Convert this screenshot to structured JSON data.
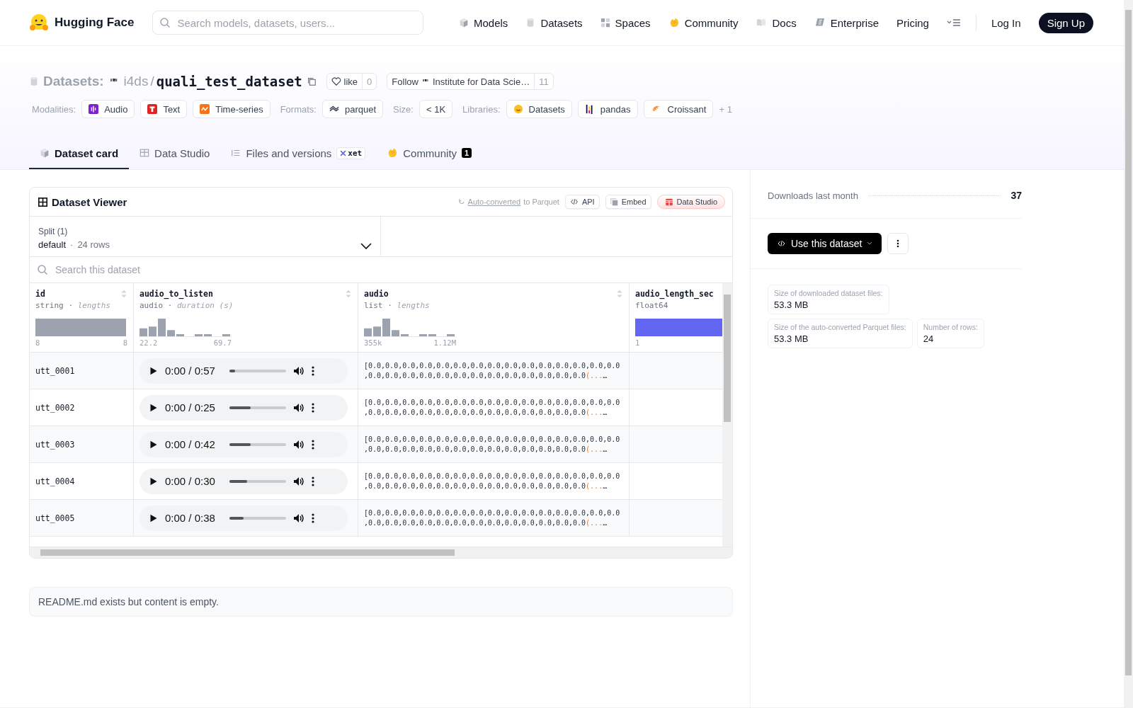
{
  "header": {
    "brand": "Hugging Face",
    "search_placeholder": "Search models, datasets, users...",
    "nav": [
      {
        "label": "Models"
      },
      {
        "label": "Datasets"
      },
      {
        "label": "Spaces"
      },
      {
        "label": "Community"
      },
      {
        "label": "Docs"
      },
      {
        "label": "Enterprise"
      },
      {
        "label": "Pricing"
      }
    ],
    "log_in": "Log In",
    "sign_up": "Sign Up"
  },
  "repo": {
    "section": "Datasets:",
    "owner": "i4ds",
    "separator": "/",
    "name": "quali_test_dataset",
    "like": {
      "label": "like",
      "count": "0"
    },
    "follow": {
      "label": "Follow",
      "org": "Institute for Data Scie…",
      "count": "11"
    }
  },
  "tag_groups": [
    {
      "label": "Modalities:",
      "tags": [
        "Audio",
        "Text",
        "Time-series"
      ]
    },
    {
      "label": "Formats:",
      "tags": [
        "parquet"
      ]
    },
    {
      "label": "Size:",
      "tags": [
        "< 1K"
      ]
    },
    {
      "label": "Libraries:",
      "tags": [
        "Datasets",
        "pandas",
        "Croissant"
      ]
    }
  ],
  "more_tags": "+ 1",
  "tabs": [
    {
      "label": "Dataset card",
      "selected": true
    },
    {
      "label": "Data Studio",
      "selected": false
    },
    {
      "label": "Files and versions",
      "selected": false,
      "badge": "xet"
    },
    {
      "label": "Community",
      "selected": false,
      "count": "1"
    }
  ],
  "viewer": {
    "title": "Dataset Viewer",
    "converted_link": "Auto-converted",
    "converted_rest": "to Parquet",
    "buttons": [
      "API",
      "Embed"
    ],
    "studio_button": "Data Studio",
    "split": {
      "label": "Split (1)",
      "value": "default",
      "separator": "·",
      "rows": "24 rows"
    },
    "search_placeholder": "Search this dataset",
    "type_separator": "·",
    "columns": [
      {
        "name": "id",
        "dtype": "string",
        "stat": "lengths",
        "min": "8",
        "max": "8",
        "sortable": true,
        "kind": "flat"
      },
      {
        "name": "audio_to_listen",
        "dtype": "audio",
        "stat": "duration (s)",
        "min": "22.2",
        "max": "69.7",
        "sortable": true,
        "kind": "histogram"
      },
      {
        "name": "audio",
        "dtype": "list",
        "stat": "lengths",
        "min": "355k",
        "max": "1.12M",
        "sortable": true,
        "kind": "histogram"
      },
      {
        "name": "audio_length_sec",
        "dtype": "float64",
        "min": "1",
        "kind": "solid"
      }
    ],
    "rows": [
      {
        "id": "utt_0001",
        "time": "0:00 / 0:57",
        "level": 0.1,
        "lines": [
          "[0.0,0.0,0.0,0.0,0.0,0.0,0.0,0.0,0.0,0.0,0.0,0.0,0.0,0.0,0.0",
          ",0.0,0.0,0.0,0.0,0.0,0.0,0.0,0.0,0.0,0.0,0.0,0.0,0.0"
        ],
        "more": "(...",
        "ellipsis": "…"
      },
      {
        "id": "utt_0002",
        "time": "0:00 / 0:25",
        "level": 0.37,
        "lines": [
          "[0.0,0.0,0.0,0.0,0.0,0.0,0.0,0.0,0.0,0.0,0.0,0.0,0.0,0.0,0.0",
          ",0.0,0.0,0.0,0.0,0.0,0.0,0.0,0.0,0.0,0.0,0.0,0.0,0.0"
        ],
        "more": "(...",
        "ellipsis": "…"
      },
      {
        "id": "utt_0003",
        "time": "0:00 / 0:42",
        "level": 0.37,
        "lines": [
          "[0.0,0.0,0.0,0.0,0.0,0.0,0.0,0.0,0.0,0.0,0.0,0.0,0.0,0.0,0.0",
          ",0.0,0.0,0.0,0.0,0.0,0.0,0.0,0.0,0.0,0.0,0.0,0.0,0.0"
        ],
        "more": "(...",
        "ellipsis": "…"
      },
      {
        "id": "utt_0004",
        "time": "0:00 / 0:30",
        "level": 0.31,
        "lines": [
          "[0.0,0.0,0.0,0.0,0.0,0.0,0.0,0.0,0.0,0.0,0.0,0.0,0.0,0.0,0.0",
          ",0.0,0.0,0.0,0.0,0.0,0.0,0.0,0.0,0.0,0.0,0.0,0.0,0.0"
        ],
        "more": "(...",
        "ellipsis": "…"
      },
      {
        "id": "utt_0005",
        "time": "0:00 / 0:38",
        "level": 0.25,
        "lines": [
          "[0.0,0.0,0.0,0.0,0.0,0.0,0.0,0.0,0.0,0.0,0.0,0.0,0.0,0.0,0.0",
          ",0.0,0.0,0.0,0.0,0.0,0.0,0.0,0.0,0.0,0.0,0.0,0.0,0.0"
        ],
        "more": "(...",
        "ellipsis": "…"
      }
    ]
  },
  "readme": "README.md exists but content is empty.",
  "sidebar": {
    "downloads_label": "Downloads last month",
    "downloads": "37",
    "use_button": "Use this dataset",
    "stats": [
      {
        "label": "Size of downloaded dataset files:",
        "value": "53.3 MB"
      },
      {
        "label": "Size of the auto-converted Parquet files:",
        "value": "53.3 MB"
      },
      {
        "label": "Number of rows:",
        "value": "24"
      }
    ]
  }
}
